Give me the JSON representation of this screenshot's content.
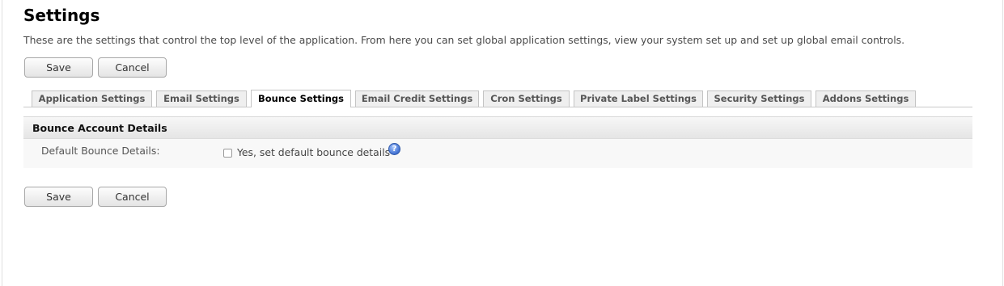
{
  "page": {
    "title": "Settings",
    "intro": "These are the settings that control the top level of the application. From here you can set global application settings, view your system set up and set up global email controls."
  },
  "buttons": {
    "save": "Save",
    "cancel": "Cancel"
  },
  "tabs": [
    {
      "label": "Application Settings",
      "active": false
    },
    {
      "label": "Email Settings",
      "active": false
    },
    {
      "label": "Bounce Settings",
      "active": true
    },
    {
      "label": "Email Credit Settings",
      "active": false
    },
    {
      "label": "Cron Settings",
      "active": false
    },
    {
      "label": "Private Label Settings",
      "active": false
    },
    {
      "label": "Security Settings",
      "active": false
    },
    {
      "label": "Addons Settings",
      "active": false
    }
  ],
  "section": {
    "title": "Bounce Account Details",
    "field_label": "Default Bounce Details:",
    "checkbox_label": "Yes, set default bounce details",
    "checkbox_checked": false,
    "help_icon": "help-icon",
    "help_glyph": "?"
  },
  "colors": {
    "help_icon": "#3f6fd1"
  }
}
